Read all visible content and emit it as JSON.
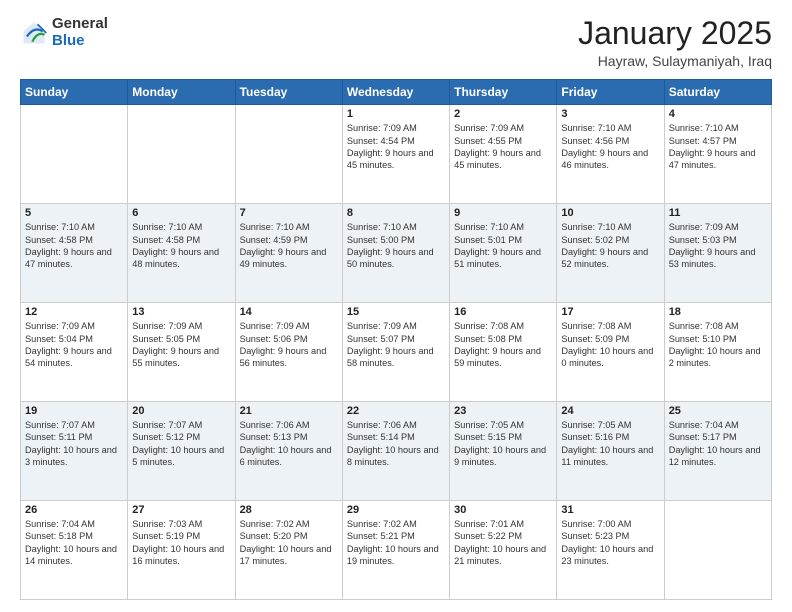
{
  "header": {
    "logo_general": "General",
    "logo_blue": "Blue",
    "month_title": "January 2025",
    "location": "Hayraw, Sulaymaniyah, Iraq"
  },
  "days_of_week": [
    "Sunday",
    "Monday",
    "Tuesday",
    "Wednesday",
    "Thursday",
    "Friday",
    "Saturday"
  ],
  "weeks": [
    [
      {
        "day": "",
        "info": ""
      },
      {
        "day": "",
        "info": ""
      },
      {
        "day": "",
        "info": ""
      },
      {
        "day": "1",
        "info": "Sunrise: 7:09 AM\nSunset: 4:54 PM\nDaylight: 9 hours\nand 45 minutes."
      },
      {
        "day": "2",
        "info": "Sunrise: 7:09 AM\nSunset: 4:55 PM\nDaylight: 9 hours\nand 45 minutes."
      },
      {
        "day": "3",
        "info": "Sunrise: 7:10 AM\nSunset: 4:56 PM\nDaylight: 9 hours\nand 46 minutes."
      },
      {
        "day": "4",
        "info": "Sunrise: 7:10 AM\nSunset: 4:57 PM\nDaylight: 9 hours\nand 47 minutes."
      }
    ],
    [
      {
        "day": "5",
        "info": "Sunrise: 7:10 AM\nSunset: 4:58 PM\nDaylight: 9 hours\nand 47 minutes."
      },
      {
        "day": "6",
        "info": "Sunrise: 7:10 AM\nSunset: 4:58 PM\nDaylight: 9 hours\nand 48 minutes."
      },
      {
        "day": "7",
        "info": "Sunrise: 7:10 AM\nSunset: 4:59 PM\nDaylight: 9 hours\nand 49 minutes."
      },
      {
        "day": "8",
        "info": "Sunrise: 7:10 AM\nSunset: 5:00 PM\nDaylight: 9 hours\nand 50 minutes."
      },
      {
        "day": "9",
        "info": "Sunrise: 7:10 AM\nSunset: 5:01 PM\nDaylight: 9 hours\nand 51 minutes."
      },
      {
        "day": "10",
        "info": "Sunrise: 7:10 AM\nSunset: 5:02 PM\nDaylight: 9 hours\nand 52 minutes."
      },
      {
        "day": "11",
        "info": "Sunrise: 7:09 AM\nSunset: 5:03 PM\nDaylight: 9 hours\nand 53 minutes."
      }
    ],
    [
      {
        "day": "12",
        "info": "Sunrise: 7:09 AM\nSunset: 5:04 PM\nDaylight: 9 hours\nand 54 minutes."
      },
      {
        "day": "13",
        "info": "Sunrise: 7:09 AM\nSunset: 5:05 PM\nDaylight: 9 hours\nand 55 minutes."
      },
      {
        "day": "14",
        "info": "Sunrise: 7:09 AM\nSunset: 5:06 PM\nDaylight: 9 hours\nand 56 minutes."
      },
      {
        "day": "15",
        "info": "Sunrise: 7:09 AM\nSunset: 5:07 PM\nDaylight: 9 hours\nand 58 minutes."
      },
      {
        "day": "16",
        "info": "Sunrise: 7:08 AM\nSunset: 5:08 PM\nDaylight: 9 hours\nand 59 minutes."
      },
      {
        "day": "17",
        "info": "Sunrise: 7:08 AM\nSunset: 5:09 PM\nDaylight: 10 hours\nand 0 minutes."
      },
      {
        "day": "18",
        "info": "Sunrise: 7:08 AM\nSunset: 5:10 PM\nDaylight: 10 hours\nand 2 minutes."
      }
    ],
    [
      {
        "day": "19",
        "info": "Sunrise: 7:07 AM\nSunset: 5:11 PM\nDaylight: 10 hours\nand 3 minutes."
      },
      {
        "day": "20",
        "info": "Sunrise: 7:07 AM\nSunset: 5:12 PM\nDaylight: 10 hours\nand 5 minutes."
      },
      {
        "day": "21",
        "info": "Sunrise: 7:06 AM\nSunset: 5:13 PM\nDaylight: 10 hours\nand 6 minutes."
      },
      {
        "day": "22",
        "info": "Sunrise: 7:06 AM\nSunset: 5:14 PM\nDaylight: 10 hours\nand 8 minutes."
      },
      {
        "day": "23",
        "info": "Sunrise: 7:05 AM\nSunset: 5:15 PM\nDaylight: 10 hours\nand 9 minutes."
      },
      {
        "day": "24",
        "info": "Sunrise: 7:05 AM\nSunset: 5:16 PM\nDaylight: 10 hours\nand 11 minutes."
      },
      {
        "day": "25",
        "info": "Sunrise: 7:04 AM\nSunset: 5:17 PM\nDaylight: 10 hours\nand 12 minutes."
      }
    ],
    [
      {
        "day": "26",
        "info": "Sunrise: 7:04 AM\nSunset: 5:18 PM\nDaylight: 10 hours\nand 14 minutes."
      },
      {
        "day": "27",
        "info": "Sunrise: 7:03 AM\nSunset: 5:19 PM\nDaylight: 10 hours\nand 16 minutes."
      },
      {
        "day": "28",
        "info": "Sunrise: 7:02 AM\nSunset: 5:20 PM\nDaylight: 10 hours\nand 17 minutes."
      },
      {
        "day": "29",
        "info": "Sunrise: 7:02 AM\nSunset: 5:21 PM\nDaylight: 10 hours\nand 19 minutes."
      },
      {
        "day": "30",
        "info": "Sunrise: 7:01 AM\nSunset: 5:22 PM\nDaylight: 10 hours\nand 21 minutes."
      },
      {
        "day": "31",
        "info": "Sunrise: 7:00 AM\nSunset: 5:23 PM\nDaylight: 10 hours\nand 23 minutes."
      },
      {
        "day": "",
        "info": ""
      }
    ]
  ]
}
